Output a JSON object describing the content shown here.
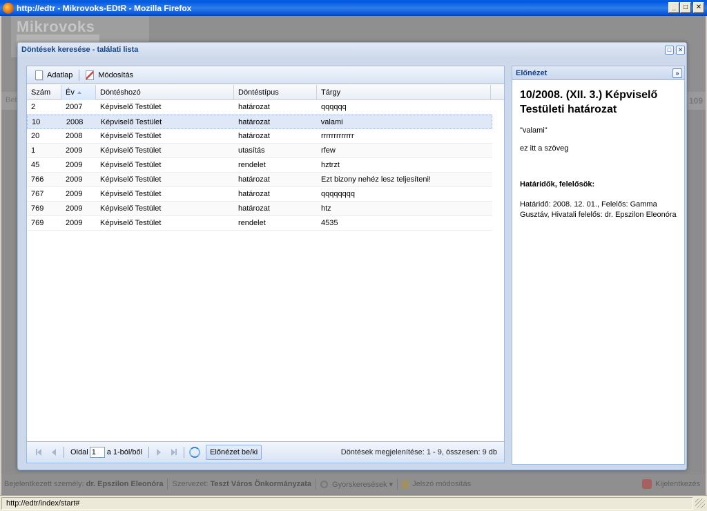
{
  "window": {
    "title": "http://edtr - Mikrovoks-EDtR - Mozilla Firefox"
  },
  "app": {
    "logo": "Mikrovoks",
    "band_left": "Bet",
    "band_right": "109"
  },
  "footer": {
    "logged_label": "Bejelentkezett személy:",
    "logged_user": "dr. Epszilon Eleonóra",
    "org_label": "Szervezet:",
    "org_name": "Teszt Város Önkormányzata",
    "quick_search": "Gyorskeresések ▾",
    "password_change": "Jelszó módosítás",
    "logout": "Kijelentkezés"
  },
  "statusbar": {
    "url": "http://edtr/index/start#"
  },
  "dialog": {
    "title": "Döntések keresése - találati lista"
  },
  "toolbar": {
    "datasheet_label": "Adatlap",
    "edit_label": "Módosítás"
  },
  "grid": {
    "columns": [
      "Szám",
      "Év",
      "Döntéshozó",
      "Döntéstípus",
      "Tárgy"
    ],
    "rows": [
      [
        "2",
        "2007",
        "Képviselő Testület",
        "határozat",
        "qqqqqq"
      ],
      [
        "10",
        "2008",
        "Képviselő Testület",
        "határozat",
        "valami"
      ],
      [
        "20",
        "2008",
        "Képviselő Testület",
        "határozat",
        "rrrrrrrrrrrrr"
      ],
      [
        "1",
        "2009",
        "Képviselő Testület",
        "utasítás",
        "rfew"
      ],
      [
        "45",
        "2009",
        "Képviselő Testület",
        "rendelet",
        "hztrzt"
      ],
      [
        "766",
        "2009",
        "Képviselő Testület",
        "határozat",
        "Ezt bizony nehéz lesz teljesíteni!"
      ],
      [
        "767",
        "2009",
        "Képviselő Testület",
        "határozat",
        "qqqqqqqq"
      ],
      [
        "769",
        "2009",
        "Képviselő Testület",
        "határozat",
        "htz"
      ],
      [
        "769",
        "2009",
        "Képviselő Testület",
        "rendelet",
        "4535"
      ]
    ],
    "selected_row": 1
  },
  "pager": {
    "page_label": "Oldal",
    "page_value": "1",
    "page_of": "a 1-ból/ből",
    "preview_toggle": "Előnézet be/ki",
    "display_info": "Döntések megjelenítése: 1 - 9, összesen: 9 db"
  },
  "preview": {
    "header": "Előnézet",
    "title": "10/2008. (XII. 3.) Képviselő Testületi határozat",
    "quote": "\"valami\"",
    "text": "ez itt a szöveg",
    "subhead": "Határidők, felelősök:",
    "deadline": "Határidő: 2008. 12. 01., Felelős: Gamma Gusztáv, Hivatali felelős: dr. Epszilon Eleonóra"
  }
}
